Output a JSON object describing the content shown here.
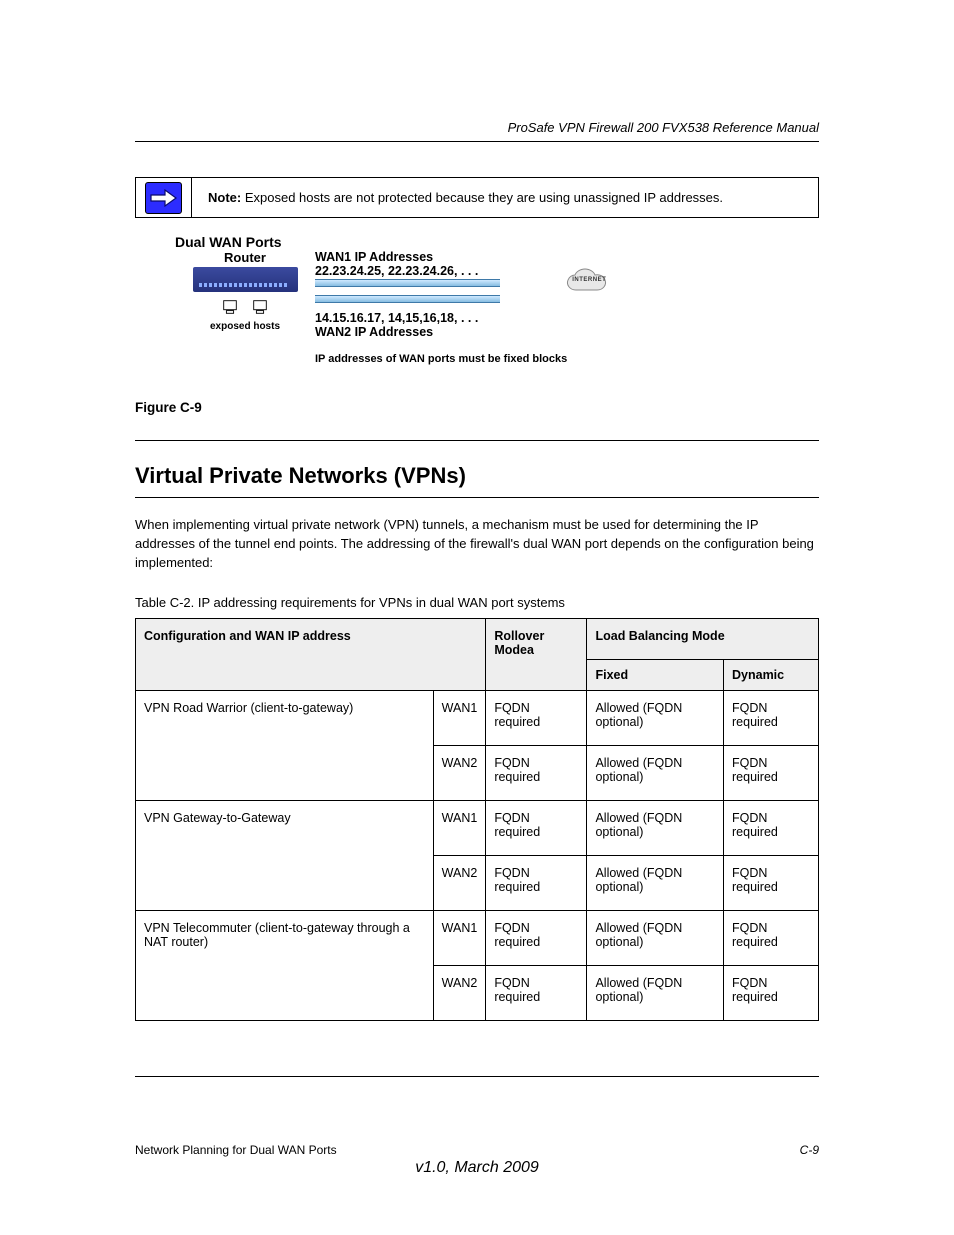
{
  "header": {
    "product_title": "ProSafe VPN Firewall 200 FVX538 Reference Manual"
  },
  "note": {
    "label": "Note:",
    "text": "Exposed hosts are not protected because they are using unassigned IP addresses."
  },
  "diagram": {
    "title": "Dual WAN Ports",
    "router_label": "Router",
    "wan1_label": "WAN1 IP Addresses",
    "wan1_ips": "22.23.24.25, 22.23.24.26, . . .",
    "wan2_ips": "14.15.16.17, 14,15,16,18, . . .",
    "wan2_label": "WAN2 IP Addresses",
    "internet_label": "INTERNET",
    "hosts_label": "exposed hosts",
    "ip_note": "IP addresses of WAN ports must be fixed blocks"
  },
  "figure_caption": "Figure C-9",
  "section_title": "Virtual Private Networks (VPNs)",
  "section_body": "When implementing virtual private network (VPN) tunnels, a mechanism must be used for determining the IP addresses of the tunnel end points. The addressing of the firewall's dual WAN port depends on the configuration being implemented:",
  "table_caption": "Table C-2.  IP addressing requirements for VPNs in dual WAN port systems",
  "table": {
    "head_config": "Configuration and WAN IP address",
    "head_rollover": "Rollover Modea",
    "head_lb": "Load Balancing Mode",
    "head_fixed": "Fixed",
    "head_dynamic": "Dynamic",
    "rows": [
      {
        "config": "VPN Road Warrior (client-to-gateway)",
        "port": "WAN1",
        "rollover": "FQDN required",
        "fixed": "Allowed (FQDN optional)",
        "dynamic": "FQDN required"
      },
      {
        "config": "",
        "port": "WAN2",
        "rollover": "FQDN required",
        "fixed": "Allowed (FQDN optional)",
        "dynamic": "FQDN required"
      },
      {
        "config": "VPN Gateway-to-Gateway",
        "port": "WAN1",
        "rollover": "FQDN required",
        "fixed": "Allowed (FQDN optional)",
        "dynamic": "FQDN required"
      },
      {
        "config": "",
        "port": "WAN2",
        "rollover": "FQDN required",
        "fixed": "Allowed (FQDN optional)",
        "dynamic": "FQDN required"
      },
      {
        "config": "VPN Telecommuter (client-to-gateway through a NAT router)",
        "port": "WAN1",
        "rollover": "FQDN required",
        "fixed": "Allowed (FQDN optional)",
        "dynamic": "FQDN required"
      },
      {
        "config": "",
        "port": "WAN2",
        "rollover": "FQDN required",
        "fixed": "Allowed (FQDN optional)",
        "dynamic": "FQDN required"
      }
    ]
  },
  "footer": {
    "left": "Network Planning for Dual WAN Ports",
    "right": "C-9",
    "version": "v1.0, March 2009"
  }
}
